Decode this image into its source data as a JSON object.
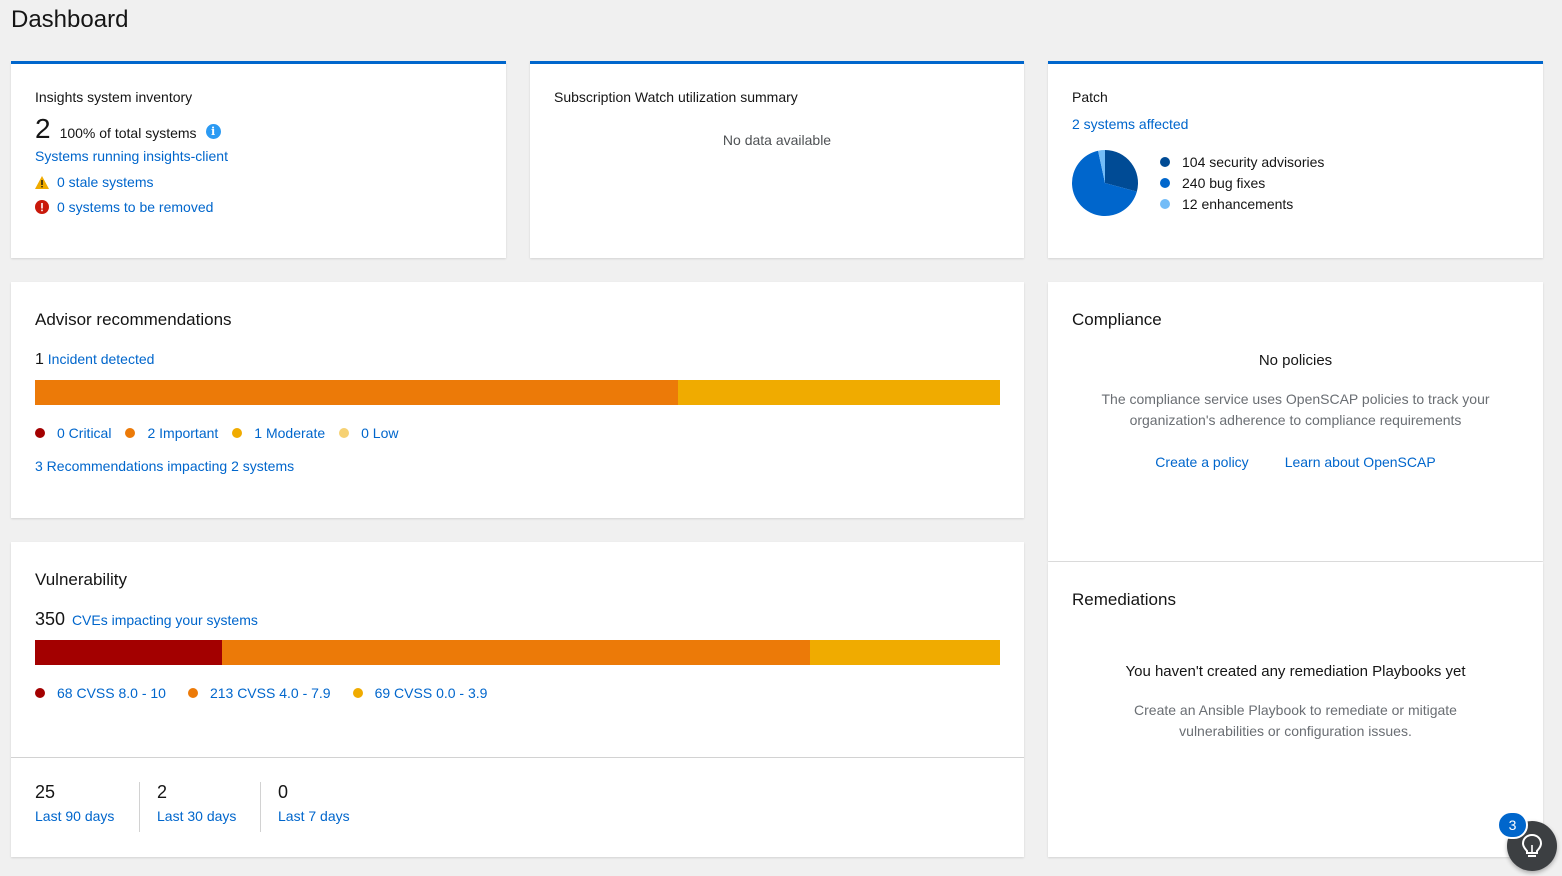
{
  "page": {
    "title": "Dashboard"
  },
  "inventory": {
    "label": "Insights system inventory",
    "count": "2",
    "percent_text": "100% of total systems",
    "running_link": "Systems running insights-client",
    "stale_link": "0 stale systems",
    "removed_link": "0 systems to be removed"
  },
  "subscription": {
    "label": "Subscription Watch utilization summary",
    "empty": "No data available"
  },
  "patch": {
    "label": "Patch",
    "affected_link": "2 systems affected",
    "legend": [
      {
        "label": "104 security advisories",
        "value": 104,
        "color": "#004b95"
      },
      {
        "label": "240 bug fixes",
        "value": 240,
        "color": "#0066cc"
      },
      {
        "label": "12 enhancements",
        "value": 12,
        "color": "#73bcf7"
      }
    ]
  },
  "advisor": {
    "title": "Advisor recommendations",
    "incident_count": "1",
    "incident_link": "Incident detected",
    "bar": [
      {
        "name": "important",
        "value": 2,
        "color": "#ec7a08"
      },
      {
        "name": "moderate",
        "value": 1,
        "color": "#f0ab00"
      }
    ],
    "legend": [
      {
        "label": "0 Critical",
        "color": "#a30000"
      },
      {
        "label": "2 Important",
        "color": "#ec7a08"
      },
      {
        "label": "1 Moderate",
        "color": "#f0ab00"
      },
      {
        "label": "0 Low",
        "color": "#f6d173"
      }
    ],
    "recommendations_link": "3 Recommendations impacting 2 systems"
  },
  "vulnerability": {
    "title": "Vulnerability",
    "cve_count": "350",
    "cve_link": "CVEs impacting your systems",
    "bar": [
      {
        "name": "critical",
        "value": 68,
        "color": "#a30000"
      },
      {
        "name": "important",
        "value": 213,
        "color": "#ec7a08"
      },
      {
        "name": "moderate",
        "value": 69,
        "color": "#f0ab00"
      }
    ],
    "legend": [
      {
        "label": "68 CVSS 8.0 - 10",
        "color": "#a30000"
      },
      {
        "label": "213 CVSS 4.0 - 7.9",
        "color": "#ec7a08"
      },
      {
        "label": "69 CVSS 0.0 - 3.9",
        "color": "#f0ab00"
      }
    ],
    "stats": [
      {
        "value": "25",
        "label": "Last 90 days"
      },
      {
        "value": "2",
        "label": "Last 30 days"
      },
      {
        "value": "0",
        "label": "Last 7 days"
      }
    ]
  },
  "compliance": {
    "title": "Compliance",
    "empty_title": "No policies",
    "empty_body_line1": "The compliance service uses OpenSCAP policies to track your",
    "empty_body_line2": "organization's adherence to compliance requirements",
    "create_link": "Create a policy",
    "learn_link": "Learn about OpenSCAP"
  },
  "remediations": {
    "title": "Remediations",
    "empty_title": "You haven't created any remediation Playbooks yet",
    "empty_body_line1": "Create an Ansible Playbook to remediate or mitigate",
    "empty_body_line2": "vulnerabilities or configuration issues."
  },
  "help": {
    "badge": "3",
    "icon": "lightbulb-icon"
  }
}
